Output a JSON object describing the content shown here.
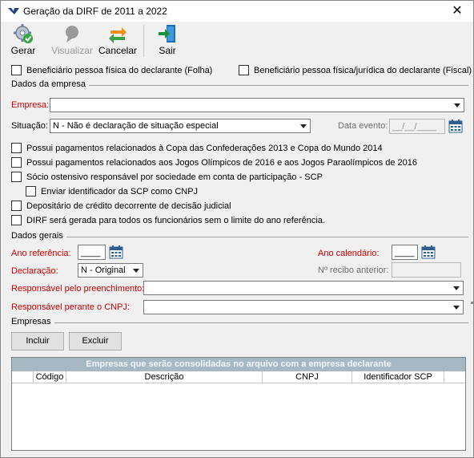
{
  "window": {
    "title": "Geração da DIRF de 2011 a 2022",
    "close_glyph": "✕"
  },
  "toolbar": {
    "gerar": "Gerar",
    "visualizar": "Visualizar",
    "cancelar": "Cancelar",
    "sair": "Sair"
  },
  "top_checks": {
    "folha": "Beneficiário pessoa física do declarante (Folha)",
    "fiscal": "Beneficiário pessoa física/jurídica do declarante (Fiscal)"
  },
  "dados_empresa": {
    "section": "Dados da empresa",
    "empresa_label": "Empresa:",
    "empresa_value": "",
    "situacao_label": "Situação:",
    "situacao_value": "N - Não é declaração de situação especial",
    "data_evento_label": "Data evento:",
    "data_evento_value": "__/__/____",
    "checks": [
      "Possui pagamentos relacionados à Copa das Confederações 2013 e Copa do Mundo 2014",
      "Possui pagamentos relacionados aos Jogos Olímpicos de 2016 e aos Jogos Paraolímpicos de 2016",
      "Sócio ostensivo responsável por sociedade em conta de participação - SCP",
      "Enviar identificador da SCP como CNPJ",
      "Depositário de crédito decorrente de decisão judicial",
      "DIRF será gerada para todos os funcionários sem o limite do ano referência."
    ]
  },
  "dados_gerais": {
    "section": "Dados gerais",
    "ano_ref_label": "Ano referência:",
    "ano_ref_value": "____",
    "ano_cal_label": "Ano calendário:",
    "ano_cal_value": "____",
    "declaracao_label": "Declaração:",
    "declaracao_value": "N - Original",
    "recibo_label": "Nº recibo anterior:",
    "recibo_value": "",
    "resp_preench_label": "Responsável pelo preenchimento:",
    "resp_cnpj_label": "Responsável perante o CNPJ:"
  },
  "empresas": {
    "section": "Empresas",
    "incluir": "Incluir",
    "excluir": "Excluir",
    "grid_caption": "Empresas que serão consolidadas no arquivo com a empresa declarante",
    "columns": [
      "Código",
      "Descrição",
      "CNPJ",
      "Identificador SCP"
    ]
  },
  "colors": {
    "required_label": "#d00000",
    "grid_caption_bg": "#a6b8c4"
  },
  "icons": [
    "app-logo-icon",
    "gerar-gear-check-icon",
    "visualizar-icon",
    "cancelar-arrows-icon",
    "sair-exit-icon",
    "calendar-icon",
    "chevron-down-icon"
  ]
}
